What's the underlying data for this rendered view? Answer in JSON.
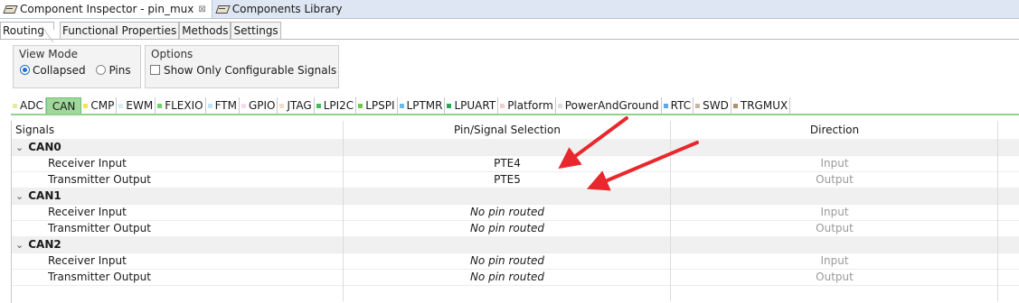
{
  "top_tabs": [
    {
      "label": "Component Inspector - pin_mux",
      "close": "⊠"
    },
    {
      "label": "Components Library"
    }
  ],
  "sub_tabs": [
    "Routing",
    "Functional Properties",
    "Methods",
    "Settings"
  ],
  "view_mode": {
    "title": "View Mode",
    "options": [
      "Collapsed",
      "Pins"
    ],
    "selected": "Collapsed"
  },
  "options": {
    "title": "Options",
    "checkbox_label": "Show Only Configurable Signals",
    "checked": false
  },
  "periph_tabs": [
    {
      "label": "ADC",
      "color": "#e8e8a0"
    },
    {
      "label": "CAN",
      "color": "#9fd89a",
      "active": true
    },
    {
      "label": "CMP",
      "color": "#f0e45c"
    },
    {
      "label": "EWM",
      "color": "#d6ecf6"
    },
    {
      "label": "FLEXIO",
      "color": "#6ad36a"
    },
    {
      "label": "FTM",
      "color": "#bfe3f7"
    },
    {
      "label": "GPIO",
      "color": "#f6d8f2"
    },
    {
      "label": "JTAG",
      "color": "#f7ddc5"
    },
    {
      "label": "LPI2C",
      "color": "#44bb55"
    },
    {
      "label": "LPSPI",
      "color": "#66cc44"
    },
    {
      "label": "LPTMR",
      "color": "#66bbee"
    },
    {
      "label": "LPUART",
      "color": "#22aa55"
    },
    {
      "label": "Platform",
      "color": "#f0d0c8"
    },
    {
      "label": "PowerAndGround",
      "color": "#dedede"
    },
    {
      "label": "RTC",
      "color": "#5aa8ee"
    },
    {
      "label": "SWD",
      "color": "#c9b7a6"
    },
    {
      "label": "TRGMUX",
      "color": "#b0906a"
    }
  ],
  "table": {
    "headers": {
      "signals": "Signals",
      "pin": "Pin/Signal Selection",
      "direction": "Direction"
    },
    "groups": [
      {
        "name": "CAN0",
        "rows": [
          {
            "signal": "Receiver Input",
            "pin": "PTE4",
            "direction": "Input",
            "routed": true
          },
          {
            "signal": "Transmitter Output",
            "pin": "PTE5",
            "direction": "Output",
            "routed": true
          }
        ]
      },
      {
        "name": "CAN1",
        "rows": [
          {
            "signal": "Receiver Input",
            "pin": "No pin routed",
            "direction": "Input",
            "routed": false
          },
          {
            "signal": "Transmitter Output",
            "pin": "No pin routed",
            "direction": "Output",
            "routed": false
          }
        ]
      },
      {
        "name": "CAN2",
        "rows": [
          {
            "signal": "Receiver Input",
            "pin": "No pin routed",
            "direction": "Input",
            "routed": false
          },
          {
            "signal": "Transmitter Output",
            "pin": "No pin routed",
            "direction": "Output",
            "routed": false
          }
        ]
      }
    ]
  },
  "colors": {
    "annotation_arrow": "#e8282d",
    "accent_green": "#8fd38a",
    "radio_selected": "#1f6fd1"
  }
}
